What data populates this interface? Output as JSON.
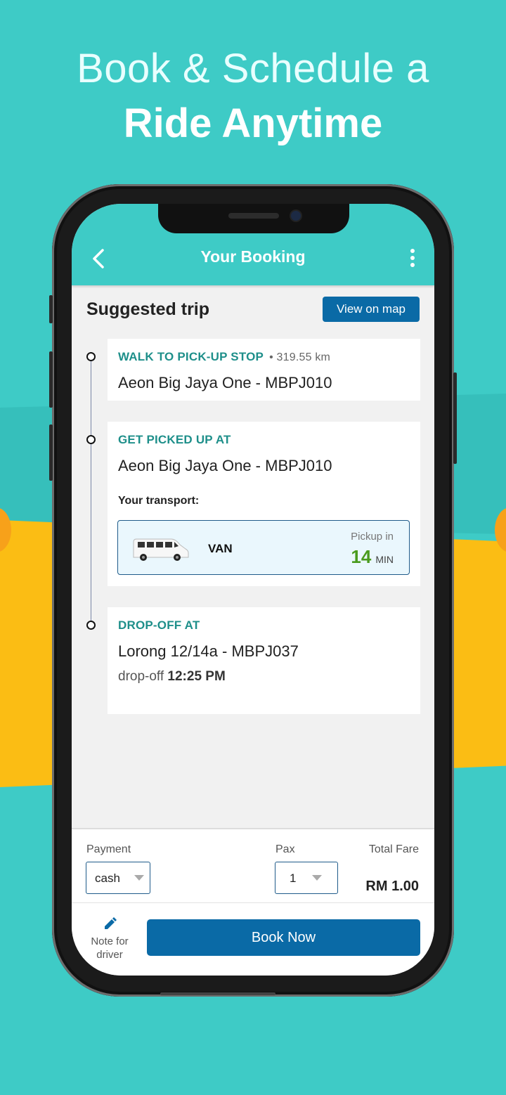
{
  "headline": {
    "line1": "Book & Schedule a",
    "line2": "Ride Anytime"
  },
  "appbar": {
    "title": "Your Booking"
  },
  "trip": {
    "heading": "Suggested trip",
    "view_map_label": "View on map"
  },
  "steps": [
    {
      "label": "WALK TO PICK-UP STOP",
      "distance": "• 319.55 km",
      "place": "Aeon Big Jaya One - MBPJ010"
    },
    {
      "label": "GET PICKED UP AT",
      "place": "Aeon Big Jaya One - MBPJ010"
    },
    {
      "label": "DROP-OFF AT",
      "place": "Lorong 12/14a - MBPJ037",
      "dropoff_prefix": "drop-off",
      "dropoff_time": "12:25 PM"
    }
  ],
  "transport": {
    "heading": "Your transport:",
    "vehicle": "VAN",
    "pickup_label": "Pickup in",
    "pickup_minutes": "14",
    "pickup_unit": "MIN"
  },
  "payment": {
    "label": "Payment",
    "value": "cash"
  },
  "pax": {
    "label": "Pax",
    "value": "1"
  },
  "fare": {
    "label": "Total Fare",
    "value": "RM 1.00"
  },
  "note": {
    "label": "Note for driver"
  },
  "book_button": "Book Now",
  "colors": {
    "teal": "#3ecbc6",
    "primary": "#0a6aa6",
    "accent_green": "#4a9b1e",
    "step_label": "#1e8f8a",
    "yellow": "#fbbd14"
  }
}
